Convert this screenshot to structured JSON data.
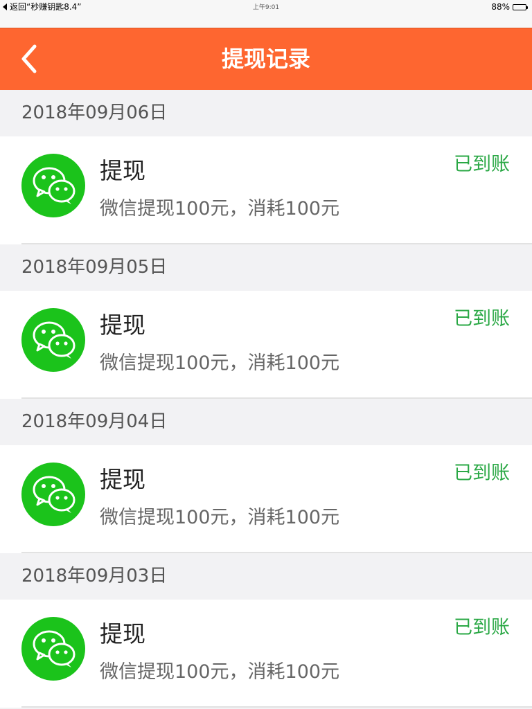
{
  "status_bar": {
    "back_label": "返回“秒赚钥匙8.4”",
    "time": "上午9:01",
    "battery": "88%",
    "battery_level": 0.88
  },
  "nav": {
    "title": "提现记录",
    "back_icon": "chevron-left-icon"
  },
  "accent_color": "#fe6630",
  "status_color": "#2aa845",
  "groups": [
    {
      "date": "2018年09月06日",
      "record": {
        "icon": "wechat-icon",
        "title": "提现",
        "description": "微信提现100元，消耗100元",
        "status": "已到账"
      }
    },
    {
      "date": "2018年09月05日",
      "record": {
        "icon": "wechat-icon",
        "title": "提现",
        "description": "微信提现100元，消耗100元",
        "status": "已到账"
      }
    },
    {
      "date": "2018年09月04日",
      "record": {
        "icon": "wechat-icon",
        "title": "提现",
        "description": "微信提现100元，消耗100元",
        "status": "已到账"
      }
    },
    {
      "date": "2018年09月03日",
      "record": {
        "icon": "wechat-icon",
        "title": "提现",
        "description": "微信提现100元，消耗100元",
        "status": "已到账"
      }
    }
  ]
}
